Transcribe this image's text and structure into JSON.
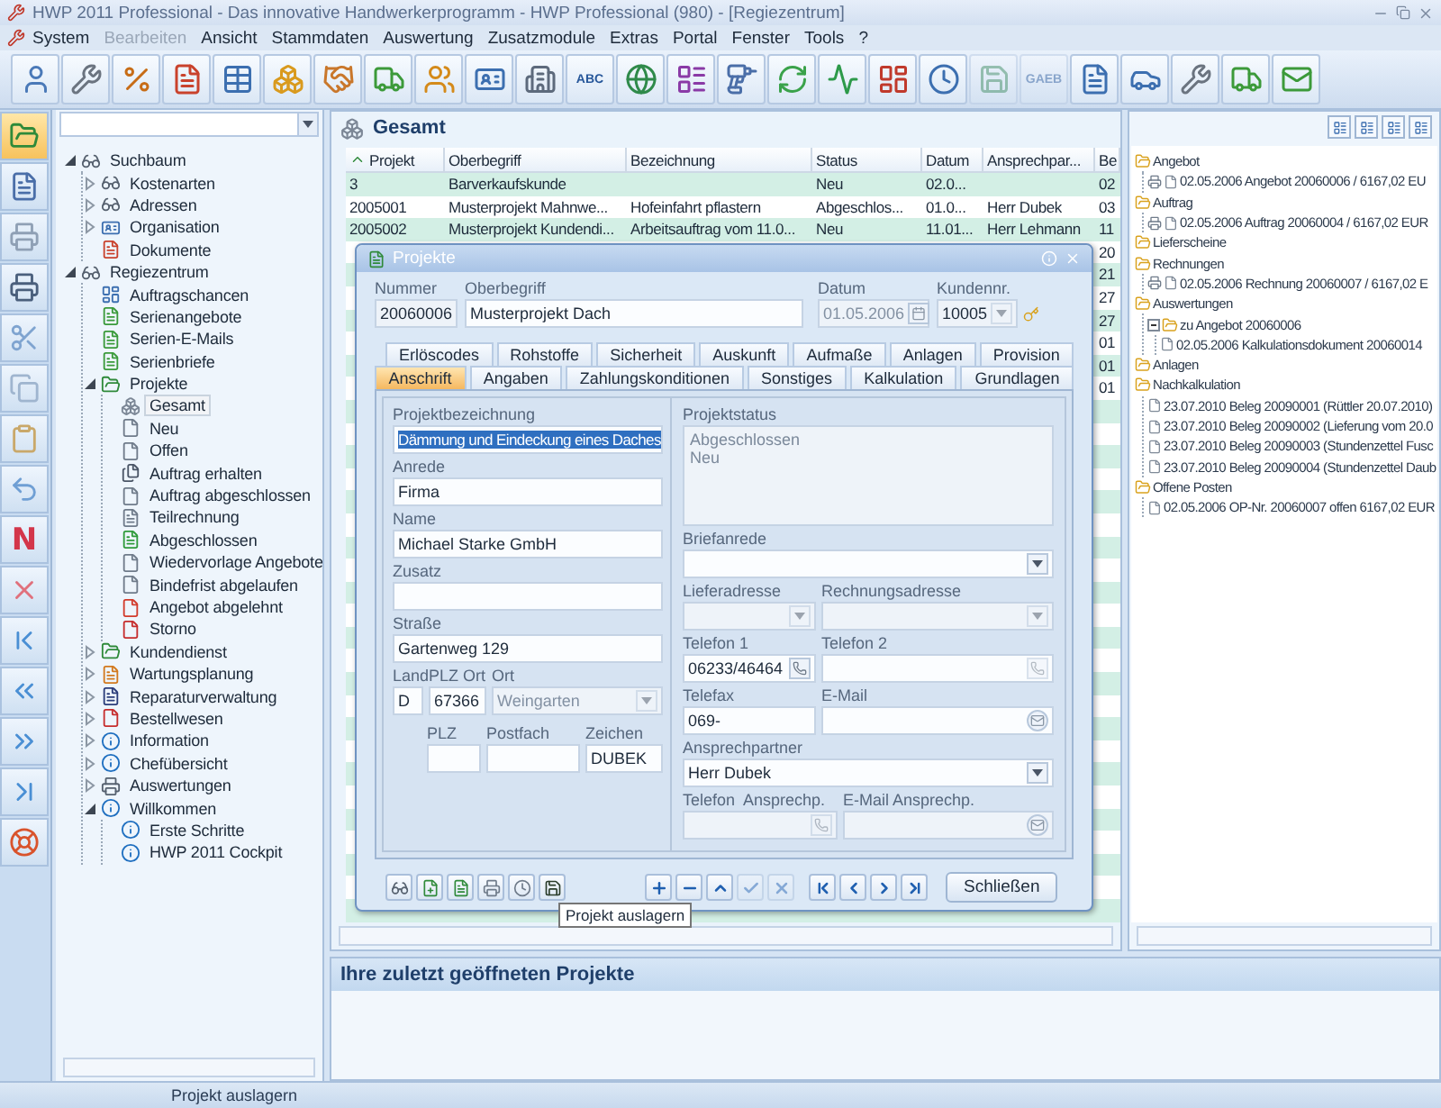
{
  "window": {
    "title": "HWP 2011 Professional - Das innovative Handwerkerprogramm - HWP Professional (980) - [Regiezentrum]"
  },
  "menu": [
    {
      "label": "System",
      "disabled": false
    },
    {
      "label": "Bearbeiten",
      "disabled": true
    },
    {
      "label": "Ansicht",
      "disabled": false
    },
    {
      "label": "Stammdaten",
      "disabled": false
    },
    {
      "label": "Auswertung",
      "disabled": false
    },
    {
      "label": "Zusatzmodule",
      "disabled": false
    },
    {
      "label": "Extras",
      "disabled": false
    },
    {
      "label": "Portal",
      "disabled": false
    },
    {
      "label": "Fenster",
      "disabled": false
    },
    {
      "label": "Tools",
      "disabled": false
    },
    {
      "label": "?",
      "disabled": false
    }
  ],
  "toolbar": [
    {
      "disabled": false
    },
    {
      "disabled": false
    },
    {
      "disabled": false
    },
    {
      "disabled": false
    },
    {
      "disabled": false
    },
    {
      "disabled": false
    },
    {
      "disabled": false
    },
    {
      "disabled": false
    },
    {
      "disabled": false
    },
    {
      "disabled": false
    },
    {
      "disabled": false
    },
    {
      "disabled": false,
      "label": "ABC"
    },
    {
      "disabled": false
    },
    {
      "disabled": false
    },
    {
      "disabled": false
    },
    {
      "disabled": false
    },
    {
      "disabled": false
    },
    {
      "disabled": false
    },
    {
      "disabled": false
    },
    {
      "disabled": true
    },
    {
      "disabled": true,
      "label": "GAEB"
    },
    {
      "disabled": false
    },
    {
      "disabled": false
    },
    {
      "disabled": false
    },
    {
      "disabled": false
    },
    {
      "disabled": false
    }
  ],
  "side_strip": [
    {
      "selected": true
    },
    {
      "selected": false
    },
    {
      "selected": false
    },
    {
      "selected": false
    },
    {
      "selected": false
    },
    {
      "selected": false
    },
    {
      "selected": false
    },
    {
      "selected": false
    },
    {
      "selected": false,
      "label": "N"
    },
    {
      "selected": false
    },
    {
      "selected": false
    },
    {
      "selected": false
    },
    {
      "selected": false
    },
    {
      "selected": false
    },
    {
      "selected": false
    }
  ],
  "tree": [
    {
      "label": "Suchbaum",
      "kind": "binoculars",
      "expanded": true,
      "selected": false,
      "children": [
        {
          "label": "Kostenarten",
          "kind": "binoculars",
          "expanded": false,
          "selected": false
        },
        {
          "label": "Adressen",
          "kind": "binoculars",
          "expanded": false,
          "selected": false
        },
        {
          "label": "Organisation",
          "kind": "card",
          "expanded": false,
          "selected": false
        },
        {
          "label": "Dokumente",
          "kind": "doc-pen",
          "selected": false
        }
      ]
    },
    {
      "label": "Regiezentrum",
      "kind": "binoculars",
      "expanded": true,
      "selected": false,
      "children": [
        {
          "label": "Auftragschancen",
          "kind": "chart",
          "selected": false
        },
        {
          "label": "Serienangebote",
          "kind": "doc-green",
          "selected": false
        },
        {
          "label": "Serien-E-Mails",
          "kind": "doc-green",
          "selected": false
        },
        {
          "label": "Serienbriefe",
          "kind": "doc-green",
          "selected": false
        },
        {
          "label": "Projekte",
          "kind": "project",
          "expanded": true,
          "selected": false,
          "children": [
            {
              "label": "Gesamt",
              "kind": "cube",
              "selected": true
            },
            {
              "label": "Neu",
              "kind": "doc",
              "selected": false
            },
            {
              "label": "Offen",
              "kind": "doc",
              "selected": false
            },
            {
              "label": "Auftrag erhalten",
              "kind": "docs",
              "selected": false
            },
            {
              "label": "Auftrag abgeschlossen",
              "kind": "doc",
              "selected": false
            },
            {
              "label": "Teilrechnung",
              "kind": "doc-lines",
              "selected": false
            },
            {
              "label": "Abgeschlossen",
              "kind": "doc-check",
              "selected": false
            },
            {
              "label": "Wiedervorlage Angebote",
              "kind": "doc",
              "selected": false
            },
            {
              "label": "Bindefrist abgelaufen",
              "kind": "doc",
              "selected": false
            },
            {
              "label": "Angebot abgelehnt",
              "kind": "doc-stop",
              "selected": false
            },
            {
              "label": "Storno",
              "kind": "doc-red",
              "selected": false
            }
          ]
        },
        {
          "label": "Kundendienst",
          "kind": "project",
          "expanded": false,
          "selected": false
        },
        {
          "label": "Wartungsplanung",
          "kind": "doc-orange",
          "expanded": false,
          "selected": false
        },
        {
          "label": "Reparaturverwaltung",
          "kind": "doc-navy",
          "expanded": false,
          "selected": false
        },
        {
          "label": "Bestellwesen",
          "kind": "doc-red",
          "expanded": false,
          "selected": false
        },
        {
          "label": "Information",
          "kind": "info",
          "expanded": false,
          "selected": false
        },
        {
          "label": "Chefübersicht",
          "kind": "info",
          "expanded": false,
          "selected": false
        },
        {
          "label": "Auswertungen",
          "kind": "printer",
          "expanded": false,
          "selected": false
        },
        {
          "label": "Willkommen",
          "kind": "info",
          "expanded": true,
          "selected": false,
          "children": [
            {
              "label": "Erste Schritte",
              "kind": "info",
              "selected": false
            },
            {
              "label": "HWP 2011 Cockpit",
              "kind": "info",
              "selected": false
            }
          ]
        }
      ]
    }
  ],
  "list_header": {
    "title": "Gesamt"
  },
  "table": {
    "columns": [
      "Projekt",
      "Oberbegriff",
      "Bezeichnung",
      "Status",
      "Datum",
      "Ansprechpar...",
      "Be"
    ],
    "rows": [
      {
        "cells": [
          "3",
          "Barverkaufskunde",
          null,
          "Neu",
          "02.0...",
          null,
          "02"
        ]
      },
      {
        "cells": [
          "2005001",
          "Musterprojekt Mahnwe...",
          "Hofeinfahrt pflastern",
          "Abgeschlos...",
          "01.0...",
          "Herr Dubek",
          "03"
        ]
      },
      {
        "cells": [
          "2005002",
          "Musterprojekt Kundendi...",
          "Arbeitsauftrag vom 11.0...",
          "Neu",
          "11.01...",
          "Herr Lehmann",
          "11"
        ]
      },
      {
        "cells": [
          null,
          null,
          null,
          null,
          null,
          null,
          "20"
        ]
      },
      {
        "cells": [
          null,
          null,
          null,
          null,
          null,
          null,
          "21"
        ]
      },
      {
        "cells": [
          null,
          null,
          null,
          null,
          null,
          null,
          "27"
        ]
      },
      {
        "cells": [
          null,
          null,
          null,
          null,
          null,
          null,
          "27"
        ]
      },
      {
        "cells": [
          null,
          null,
          null,
          null,
          null,
          null,
          "01"
        ]
      },
      {
        "cells": [
          null,
          null,
          null,
          null,
          null,
          null,
          "01"
        ]
      },
      {
        "cells": [
          null,
          null,
          null,
          null,
          null,
          null,
          "01"
        ]
      }
    ]
  },
  "dialog": {
    "title": "Projekte",
    "header_fields": [
      {
        "label": "Nummer",
        "value": "20060006",
        "kind": "readonly"
      },
      {
        "label": "Oberbegriff",
        "value": "Musterprojekt Dach",
        "kind": "text"
      },
      {
        "label": "Datum",
        "value": "01.05.2006",
        "kind": "date"
      },
      {
        "label": "Kundennr.",
        "value": "10005",
        "kind": "combo"
      }
    ],
    "tabs_back": [
      {
        "label": "Erlöscodes",
        "selected": false
      },
      {
        "label": "Rohstoffe",
        "selected": false
      },
      {
        "label": "Sicherheit",
        "selected": false
      },
      {
        "label": "Auskunft",
        "selected": false
      },
      {
        "label": "Aufmaße",
        "selected": false
      },
      {
        "label": "Anlagen",
        "selected": false
      },
      {
        "label": "Provision",
        "selected": false
      }
    ],
    "tabs_front": [
      {
        "label": "Anschrift",
        "selected": true
      },
      {
        "label": "Angaben",
        "selected": false
      },
      {
        "label": "Zahlungskonditionen",
        "selected": false
      },
      {
        "label": "Sonstiges",
        "selected": false
      },
      {
        "label": "Kalkulation",
        "selected": false
      },
      {
        "label": "Grundlagen",
        "selected": false
      }
    ],
    "projektbezeichnung": {
      "label": "Projektbezeichnung",
      "value": "Dämmung und Eindeckung eines Daches"
    },
    "anrede": {
      "label": "Anrede",
      "value": "Firma"
    },
    "name": {
      "label": "Name",
      "value": "Michael Starke GmbH"
    },
    "zusatz": {
      "label": "Zusatz"
    },
    "strasse": {
      "label": "Straße",
      "value": "Gartenweg 129"
    },
    "land": {
      "label": "Land",
      "value": "D"
    },
    "plz_ort": {
      "label": "PLZ Ort",
      "value": "67366"
    },
    "ort": {
      "label": "Ort",
      "value": "Weingarten"
    },
    "plz": {
      "label": "PLZ"
    },
    "postfach": {
      "label": "Postfach"
    },
    "zeichen": {
      "label": "Zeichen",
      "value": "DUBEK"
    },
    "projektstatus": {
      "label": "Projektstatus",
      "items": [
        "Abgeschlossen",
        "Neu"
      ]
    },
    "briefanrede": {
      "label": "Briefanrede"
    },
    "lieferadresse": {
      "label": "Lieferadresse"
    },
    "rechnungsadresse": {
      "label": "Rechnungsadresse"
    },
    "telefon1": {
      "label": "Telefon 1",
      "value": "06233/46464"
    },
    "telefon2": {
      "label": "Telefon 2"
    },
    "telefax": {
      "label": "Telefax",
      "value": "069-"
    },
    "email": {
      "label": "E-Mail"
    },
    "ansprechpartner": {
      "label": "Ansprechpartner",
      "value": "Herr Dubek"
    },
    "telefon_ansprechp": {
      "label": "Telefon  Ansprechp."
    },
    "email_ansprechp": {
      "label": "E-Mail Ansprechp."
    },
    "nav_buttons": [
      {
        "kind": "add",
        "disabled": false
      },
      {
        "kind": "remove",
        "disabled": false
      },
      {
        "kind": "up",
        "disabled": false
      },
      {
        "kind": "confirm",
        "disabled": true
      },
      {
        "kind": "cancel",
        "disabled": true
      },
      {
        "kind": "first",
        "disabled": false
      },
      {
        "kind": "prev",
        "disabled": false
      },
      {
        "kind": "next",
        "disabled": false
      },
      {
        "kind": "last",
        "disabled": false
      }
    ],
    "close_button": "Schließen",
    "tooltip": "Projekt auslagern"
  },
  "documents": [
    {
      "label": "Angebot",
      "kind": "folder",
      "children": [
        {
          "label": "02.05.2006 Angebot 20060006 / 6167,02 EU",
          "kind": "printed"
        }
      ]
    },
    {
      "label": "Auftrag",
      "kind": "folder",
      "children": [
        {
          "label": "02.05.2006 Auftrag 20060004 / 6167,02 EUR",
          "kind": "printed"
        }
      ]
    },
    {
      "label": "Lieferscheine",
      "kind": "folder"
    },
    {
      "label": "Rechnungen",
      "kind": "folder",
      "children": [
        {
          "label": "02.05.2006 Rechnung 20060007 / 6167,02 E",
          "kind": "printed"
        }
      ]
    },
    {
      "label": "Auswertungen",
      "kind": "folder",
      "children": [
        {
          "label": "zu Angebot 20060006",
          "kind": "folder",
          "expanded": true,
          "children": [
            {
              "label": "02.05.2006 Kalkulationsdokument 20060014",
              "kind": "doc"
            }
          ]
        }
      ]
    },
    {
      "label": "Anlagen",
      "kind": "folder"
    },
    {
      "label": "Nachkalkulation",
      "kind": "folder",
      "children": [
        {
          "label": "23.07.2010 Beleg 20090001 (Rüttler 20.07.2010)",
          "kind": "doc"
        },
        {
          "label": "23.07.2010 Beleg 20090002 (Lieferung vom 20.0",
          "kind": "doc"
        },
        {
          "label": "23.07.2010 Beleg 20090003 (Stundenzettel Fusc",
          "kind": "doc"
        },
        {
          "label": "23.07.2010 Beleg 20090004 (Stundenzettel Daub",
          "kind": "doc"
        }
      ]
    },
    {
      "label": "Offene Posten",
      "kind": "folder",
      "children": [
        {
          "label": "02.05.2006 OP-Nr. 20060007 offen 6167,02 EUR",
          "kind": "doc"
        }
      ]
    }
  ],
  "recent": {
    "title": "Ihre zuletzt geöffneten Projekte"
  },
  "status_bar": {
    "text": "Projekt auslagern"
  }
}
